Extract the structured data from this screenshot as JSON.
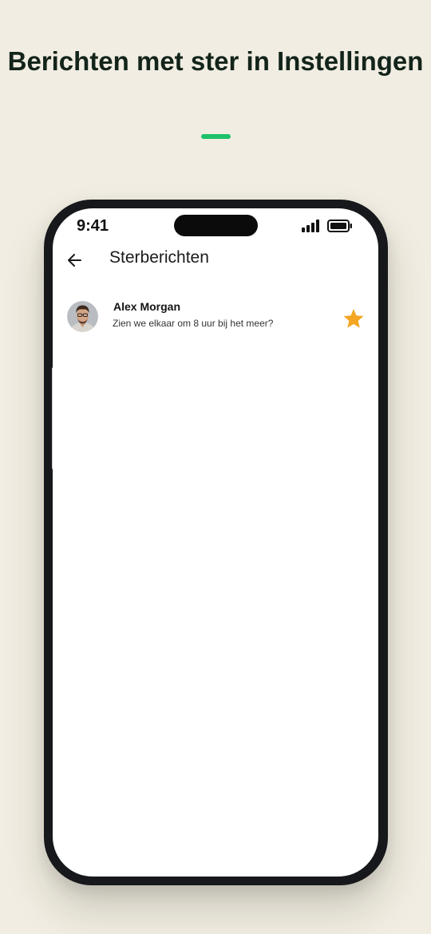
{
  "promo": {
    "title": "Berichten met ster in Instellingen",
    "accent_color": "#1ec26a"
  },
  "status_bar": {
    "time": "9:41",
    "signal_icon": "cellular-signal-icon",
    "battery_icon": "battery-icon"
  },
  "header": {
    "back_icon": "arrow-left-icon",
    "title": "Sterberichten"
  },
  "messages": [
    {
      "sender": "Alex Morgan",
      "text": "Zien we elkaar om 8 uur bij het meer?",
      "starred": true,
      "star_icon": "star-icon",
      "star_color": "#f4a623"
    }
  ]
}
